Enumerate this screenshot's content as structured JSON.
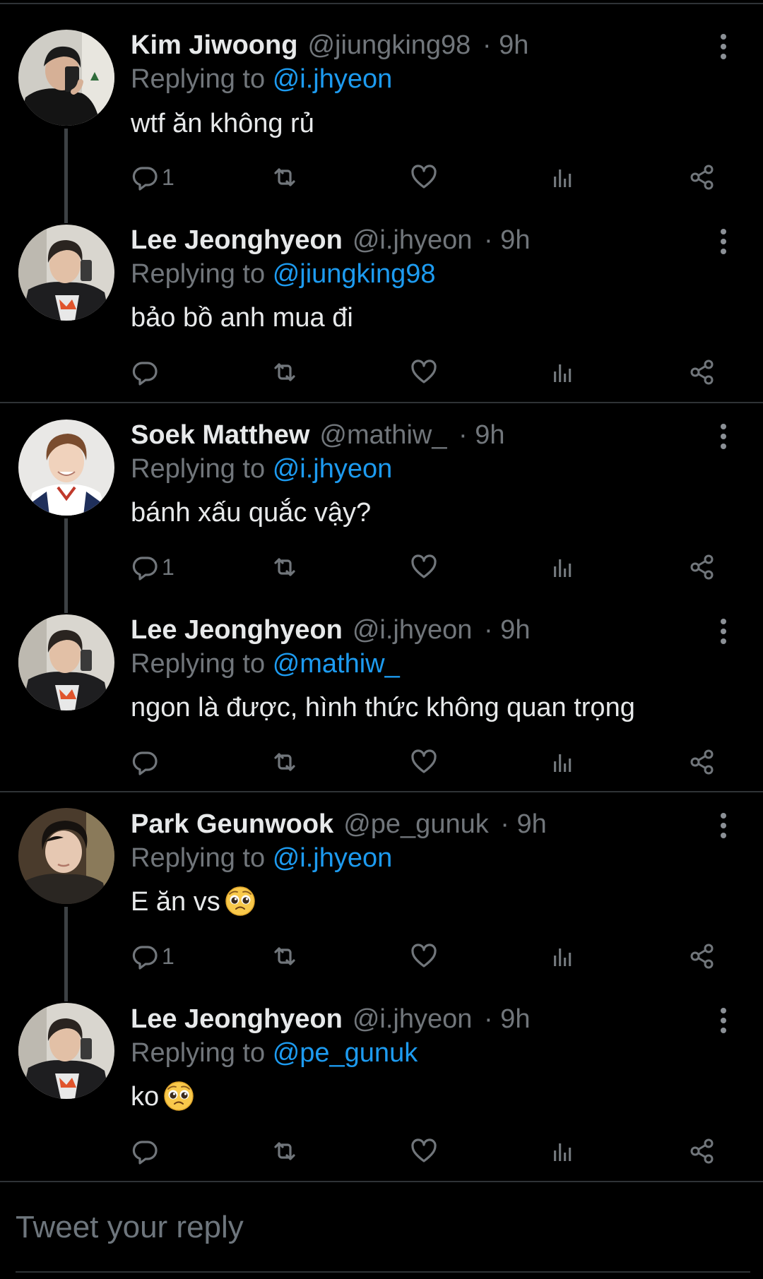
{
  "reply_prefix": "Replying to",
  "tweets": [
    {
      "name": "Kim Jiwoong",
      "handle": "@jiungking98",
      "time": "· 9h",
      "reply_to": "@i.jhyeon",
      "text": "wtf ăn không rủ",
      "reply_count": "1",
      "emoji": null
    },
    {
      "name": "Lee Jeonghyeon",
      "handle": "@i.jhyeon",
      "time": "· 9h",
      "reply_to": "@jiungking98",
      "text": "bảo bồ anh mua đi",
      "reply_count": "",
      "emoji": null
    },
    {
      "name": "Soek Matthew",
      "handle": "@mathiw_",
      "time": "· 9h",
      "reply_to": "@i.jhyeon",
      "text": "bánh xấu quắc vậy?",
      "reply_count": "1",
      "emoji": null
    },
    {
      "name": "Lee Jeonghyeon",
      "handle": "@i.jhyeon",
      "time": "· 9h",
      "reply_to": "@mathiw_",
      "text": "ngon là được, hình thức không quan trọng",
      "reply_count": "",
      "emoji": null
    },
    {
      "name": "Park Geunwook",
      "handle": "@pe_gunuk",
      "time": "· 9h",
      "reply_to": "@i.jhyeon",
      "text": "E ăn vs",
      "reply_count": "1",
      "emoji": "pleading-face"
    },
    {
      "name": "Lee Jeonghyeon",
      "handle": "@i.jhyeon",
      "time": "· 9h",
      "reply_to": "@pe_gunuk",
      "text": "ko",
      "reply_count": "",
      "emoji": "pleading-face"
    }
  ],
  "actions": {
    "reply_icon": "reply-icon",
    "retweet_icon": "retweet-icon",
    "like_icon": "heart-icon",
    "analytics_icon": "analytics-icon",
    "share_icon": "share-icon",
    "more_icon": "more-vertical-icon"
  },
  "composer": {
    "placeholder": "Tweet your reply"
  },
  "colors": {
    "background": "#000000",
    "name": "#e7e9ea",
    "secondary": "#71767b",
    "mention": "#1d9bf0",
    "divider": "#2f3336"
  }
}
